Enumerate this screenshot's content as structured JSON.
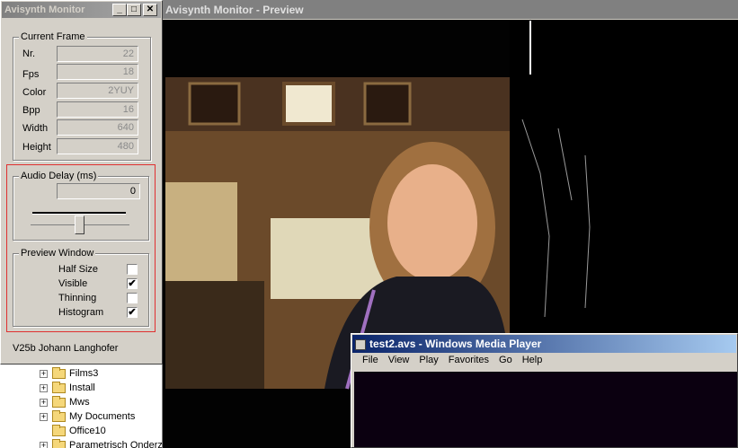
{
  "monitor": {
    "title": "Avisynth Monitor",
    "buttons": {
      "minimize": "_",
      "maximize": "□",
      "close": "✕"
    },
    "current_frame": {
      "title": "Current Frame",
      "rows": [
        {
          "label": "Nr.",
          "value": "22"
        },
        {
          "label": "Fps",
          "value": "18"
        },
        {
          "label": "Color",
          "value": "2YUY"
        },
        {
          "label": "Bpp",
          "value": "16"
        },
        {
          "label": "Width",
          "value": "640"
        },
        {
          "label": "Height",
          "value": "480"
        }
      ]
    },
    "audio_delay": {
      "title": "Audio Delay (ms)",
      "value": "0"
    },
    "preview_window": {
      "title": "Preview Window",
      "options": [
        {
          "label": "Half Size",
          "checked": false,
          "mark": ""
        },
        {
          "label": "Visible",
          "checked": true,
          "mark": "✔"
        },
        {
          "label": "Thinning",
          "checked": false,
          "mark": ""
        },
        {
          "label": "Histogram",
          "checked": true,
          "mark": "✔"
        }
      ]
    },
    "footer": "V25b Johann Langhofer"
  },
  "preview": {
    "title": "Avisynth Monitor - Preview"
  },
  "explorer": {
    "items": [
      {
        "label": "Films3",
        "expandable": true
      },
      {
        "label": "Install",
        "expandable": true
      },
      {
        "label": "Mws",
        "expandable": true
      },
      {
        "label": "My Documents",
        "expandable": true
      },
      {
        "label": "Office10",
        "expandable": false
      },
      {
        "label": "Parametrisch Onderz",
        "expandable": true
      }
    ]
  },
  "media_player": {
    "title": "test2.avs - Windows Media Player",
    "menu": [
      "File",
      "View",
      "Play",
      "Favorites",
      "Go",
      "Help"
    ]
  },
  "colors": {
    "active_title": "#0a246a",
    "inactive_title": "#808080",
    "highlight_box": "#e03030",
    "face": "#d4d0c8"
  }
}
